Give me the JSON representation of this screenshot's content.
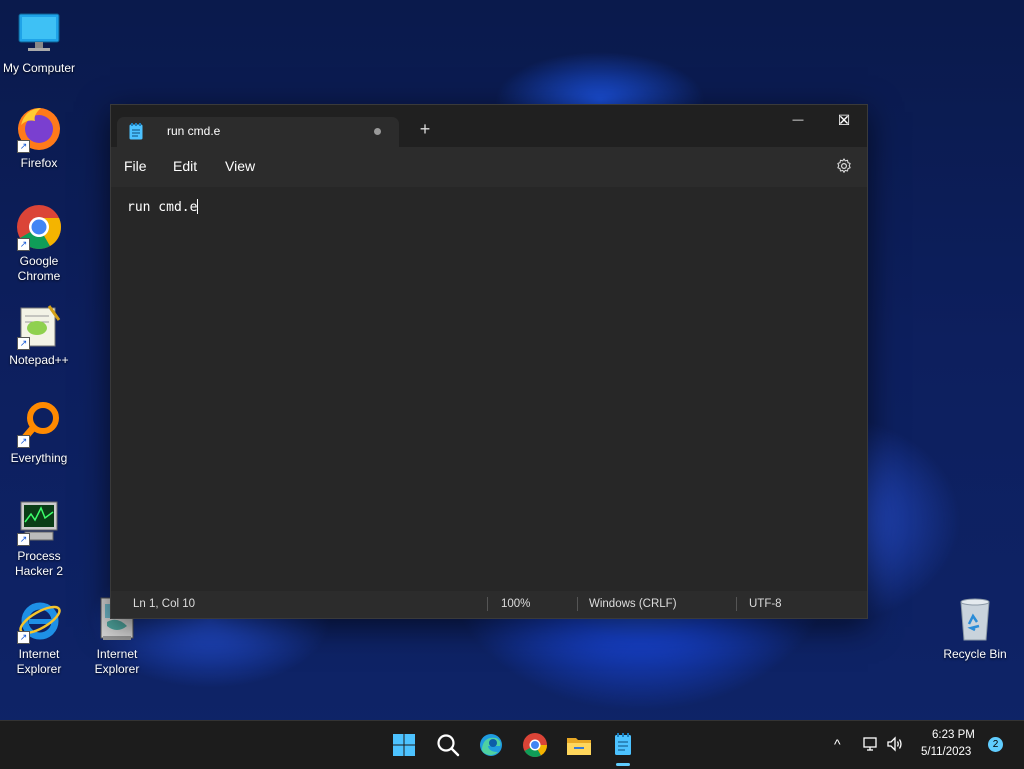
{
  "desktop": {
    "icons": [
      {
        "label": "My Computer"
      },
      {
        "label": "Firefox"
      },
      {
        "label": "Google Chrome"
      },
      {
        "label": "Notepad++"
      },
      {
        "label": "Everything"
      },
      {
        "label": "Process Hacker 2"
      },
      {
        "label": "Internet Explorer"
      },
      {
        "label": "Internet Explorer"
      },
      {
        "label": "Recycle Bin"
      }
    ],
    "shortcut_arrow": "↗"
  },
  "notepad": {
    "tab_title": "run cmd.e",
    "new_tab_symbol": "+",
    "window_controls": {
      "minimize": "—",
      "maximize": "☐",
      "close": "✕"
    },
    "menu": {
      "file": "File",
      "edit": "Edit",
      "view": "View"
    },
    "content": "run cmd.e",
    "status": {
      "position": "Ln 1, Col 10",
      "zoom": "100%",
      "line_ending": "Windows (CRLF)",
      "encoding": "UTF-8"
    }
  },
  "taskbar": {
    "chevron": "^",
    "time": "6:23 PM",
    "date": "5/11/2023",
    "notification_count": "2"
  },
  "colors": {
    "window_bg": "#272727",
    "titlebar_bg": "#202020",
    "taskbar_bg": "#1c1c1c",
    "accent": "#60cdff"
  }
}
